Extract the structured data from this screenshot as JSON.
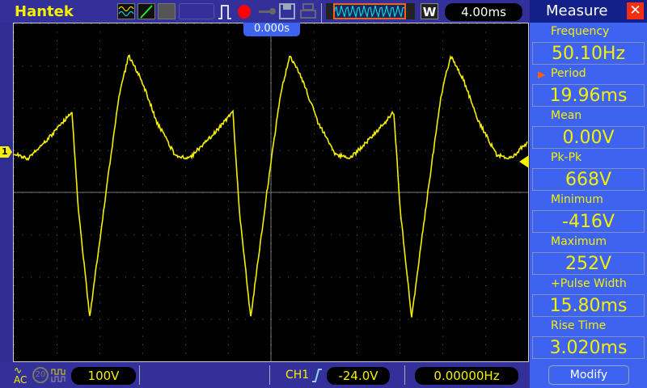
{
  "header": {
    "brand": "Hantek",
    "timebase": "4.00ms",
    "trigger_pos": "0.000s",
    "w_label": "W"
  },
  "footer": {
    "coupling": "AC",
    "bw_limit": "20",
    "volts_div": "100V",
    "trigger_source": "CH1",
    "trigger_level": "-24.0V",
    "trigger_freq": "0.00000Hz"
  },
  "measure": {
    "title": "Measure",
    "modify_label": "Modify",
    "selected": "Period",
    "items": [
      {
        "label": "Frequency",
        "value": "50.10Hz"
      },
      {
        "label": "Period",
        "value": "19.96ms"
      },
      {
        "label": "Mean",
        "value": "0.00V"
      },
      {
        "label": "Pk-Pk",
        "value": "668V"
      },
      {
        "label": "Minimum",
        "value": "-416V"
      },
      {
        "label": "Maximum",
        "value": "252V"
      },
      {
        "label": "+Pulse Width",
        "value": "15.80ms"
      },
      {
        "label": "Rise Time",
        "value": "3.020ms"
      }
    ]
  },
  "channel": {
    "marker": "1",
    "color": "#f4f000"
  }
}
